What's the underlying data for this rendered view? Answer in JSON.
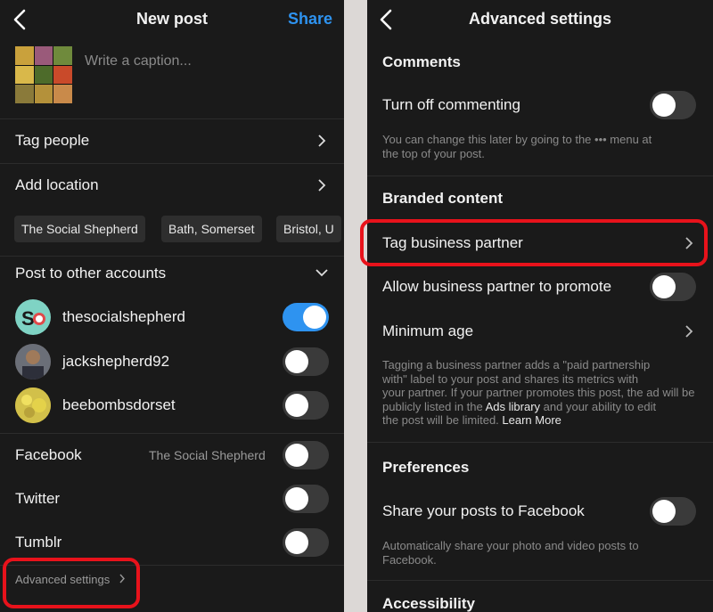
{
  "left": {
    "title": "New post",
    "share_label": "Share",
    "caption_placeholder": "Write a caption...",
    "tag_people": "Tag people",
    "add_location": "Add location",
    "location_chips": [
      "The Social Shepherd",
      "Bath, Somerset",
      "Bristol, U"
    ],
    "post_to_other_accounts": "Post to other accounts",
    "accounts": [
      {
        "name": "thesocialshepherd",
        "on": true
      },
      {
        "name": "jackshepherd92",
        "on": false
      },
      {
        "name": "beebombsdorset",
        "on": false
      }
    ],
    "facebook": {
      "label": "Facebook",
      "value": "The Social Shepherd",
      "on": false
    },
    "twitter": {
      "label": "Twitter",
      "on": false
    },
    "tumblr": {
      "label": "Tumblr",
      "on": false
    },
    "advanced_settings": "Advanced settings"
  },
  "right": {
    "title": "Advanced settings",
    "comments": {
      "heading": "Comments",
      "turn_off_label": "Turn off commenting",
      "turn_off_on": false,
      "helper_line1": "You can change this later by going to the ••• menu at",
      "helper_line2": "the top of your post."
    },
    "branded": {
      "heading": "Branded content",
      "tag_partner": "Tag business partner",
      "allow_promote": "Allow business partner to promote",
      "allow_promote_on": false,
      "minimum_age": "Minimum age",
      "helper_lines": [
        "Tagging a business partner adds a \"paid partnership",
        "with\" label to your post and shares its metrics with",
        "your partner. If your partner promotes this post, the ad will be"
      ],
      "helper_line4_a": "publicly listed in the ",
      "ads_library": "Ads library",
      "helper_line4_b": " and your ability to edit",
      "helper_line5": "the post will be limited. ",
      "learn_more": "Learn More"
    },
    "preferences": {
      "heading": "Preferences",
      "share_fb": "Share your posts to Facebook",
      "share_fb_on": false,
      "helper_line1": "Automatically share your photo and video posts to",
      "helper_line2": "Facebook."
    },
    "accessibility": "Accessibility"
  },
  "colors": {
    "accent": "#2e93f0",
    "highlight": "#e8121b",
    "background": "#1a1a1a"
  }
}
